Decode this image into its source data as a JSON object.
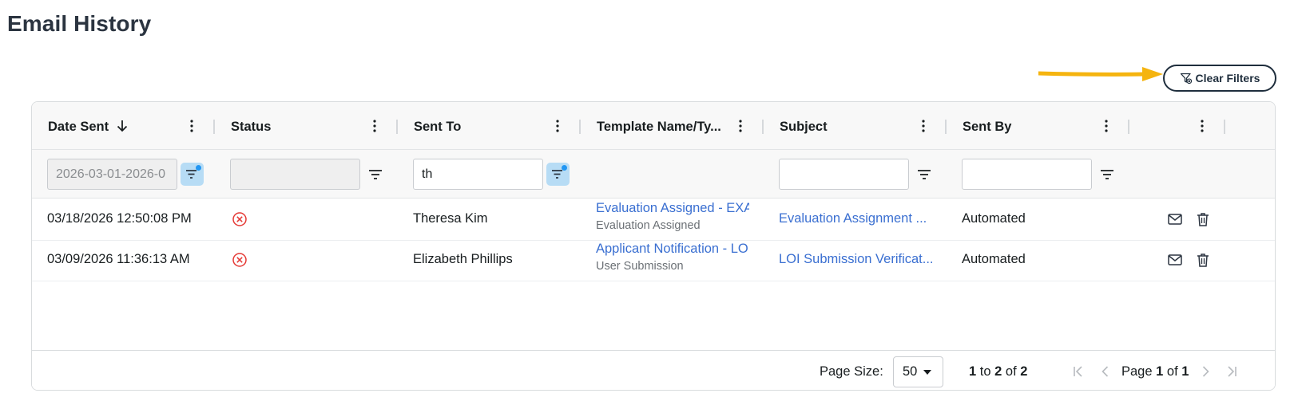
{
  "page": {
    "title": "Email History"
  },
  "toolbar": {
    "clear_filters_label": "Clear Filters"
  },
  "grid": {
    "columns": [
      {
        "label": "Date Sent",
        "sorted": "desc"
      },
      {
        "label": "Status"
      },
      {
        "label": "Sent To"
      },
      {
        "label": "Template Name/Ty..."
      },
      {
        "label": "Subject"
      },
      {
        "label": "Sent By"
      },
      {
        "label": ""
      }
    ],
    "filters": {
      "date_sent": "2026-03-01-2026-0",
      "status": "",
      "sent_to": "th",
      "subject": "",
      "sent_by": ""
    },
    "rows": [
      {
        "date_sent": "03/18/2026 12:50:08 PM",
        "status": "failed",
        "sent_to": "Theresa Kim",
        "template_name": "Evaluation Assigned - EXA",
        "template_type": "Evaluation Assigned",
        "subject": "Evaluation Assignment ...",
        "sent_by": "Automated"
      },
      {
        "date_sent": "03/09/2026 11:36:13 AM",
        "status": "failed",
        "sent_to": "Elizabeth Phillips",
        "template_name": "Applicant Notification - LO",
        "template_type": "User Submission",
        "subject": "LOI Submission Verificat...",
        "sent_by": "Automated"
      }
    ]
  },
  "pagination": {
    "page_size_label": "Page Size:",
    "page_size": "50",
    "range_from": "1",
    "range_to_word": "to",
    "range_to": "2",
    "range_of_word": "of",
    "range_total": "2",
    "page_word": "Page",
    "page_current": "1",
    "page_of_word": "of",
    "page_total": "1"
  },
  "colors": {
    "accent_arrow": "#f5b40f",
    "link": "#3a6fd1",
    "error": "#e53935",
    "filter_active_bg": "#b7dcf5"
  }
}
